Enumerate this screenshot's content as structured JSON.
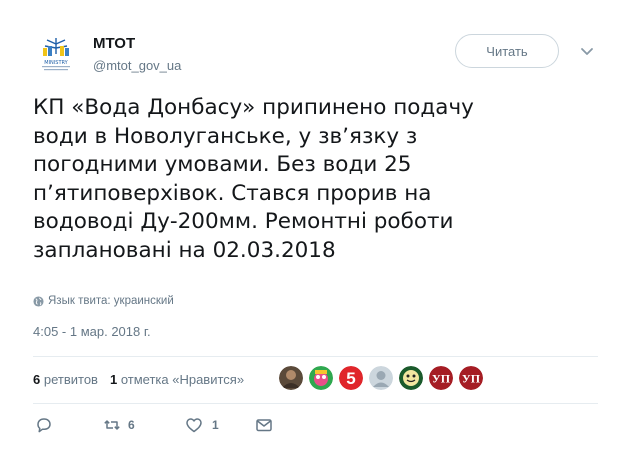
{
  "account": {
    "name": "МТОТ",
    "handle": "@mtot_gov_ua",
    "logo_text": "MINISTRY"
  },
  "follow_button": {
    "label": "Читать"
  },
  "tweet": {
    "lines": [
      "КП «Вода Донбасу» припинено подачу",
      "води в Новолуганське, у звʼязку з",
      "погодними умовами. Без води 25",
      "пʼятиповерхівок. Стався прорив на",
      "водоводі Ду-200мм. Ремонтні роботи",
      "заплановані на 02.03.2018"
    ],
    "language": "Язык твита: украинский",
    "timestamp": "4:05 - 1 мар. 2018 г."
  },
  "stats": {
    "retweets_count": "6",
    "retweets_label": "ретвитов",
    "likes_count": "1",
    "likes_label": "отметка «Нравится»"
  },
  "likers": [
    {
      "icon": "avatar-photo"
    },
    {
      "icon": "avatar-cartoon"
    },
    {
      "icon": "avatar-channel-5"
    },
    {
      "icon": "avatar-default"
    },
    {
      "icon": "avatar-meme"
    },
    {
      "icon": "avatar-up"
    },
    {
      "icon": "avatar-up"
    }
  ],
  "actions": {
    "reply_count": "",
    "retweet_count": "6",
    "like_count": "1"
  },
  "colors": {
    "text": "#14171a",
    "muted": "#657786",
    "border": "#e6ecf0",
    "channel5": "#e0262b",
    "up": "#a51d24"
  }
}
